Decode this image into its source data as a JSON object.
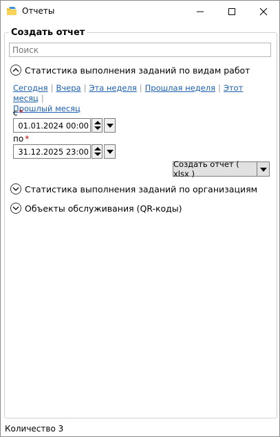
{
  "window": {
    "title": "Отчеты"
  },
  "group": {
    "title": "Создать отчет"
  },
  "search": {
    "placeholder": "Поиск"
  },
  "sections": [
    {
      "title": "Статистика выполнения заданий по видам работ",
      "expanded": true
    },
    {
      "title": "Статистика выполнения заданий по организациям",
      "expanded": false
    },
    {
      "title": "Объекты обслуживания (QR-коды)",
      "expanded": false
    }
  ],
  "quick_links": [
    "Сегодня",
    "Вчера",
    "Эта неделя",
    "Прошлая неделя",
    "Этот месяц",
    "Прошлый месяц"
  ],
  "date_from": {
    "label": "с",
    "required_mark": "*",
    "value": "01.01.2024 00:00"
  },
  "date_to": {
    "label": "по",
    "required_mark": "*",
    "value": "31.12.2025 23:00"
  },
  "report_button": {
    "label": "Создать отчет ( xlsx )"
  },
  "status": {
    "text": "Количество 3"
  },
  "colors": {
    "link": "#1a5fb4",
    "required": "#d40000",
    "border": "#7a7a7a"
  }
}
